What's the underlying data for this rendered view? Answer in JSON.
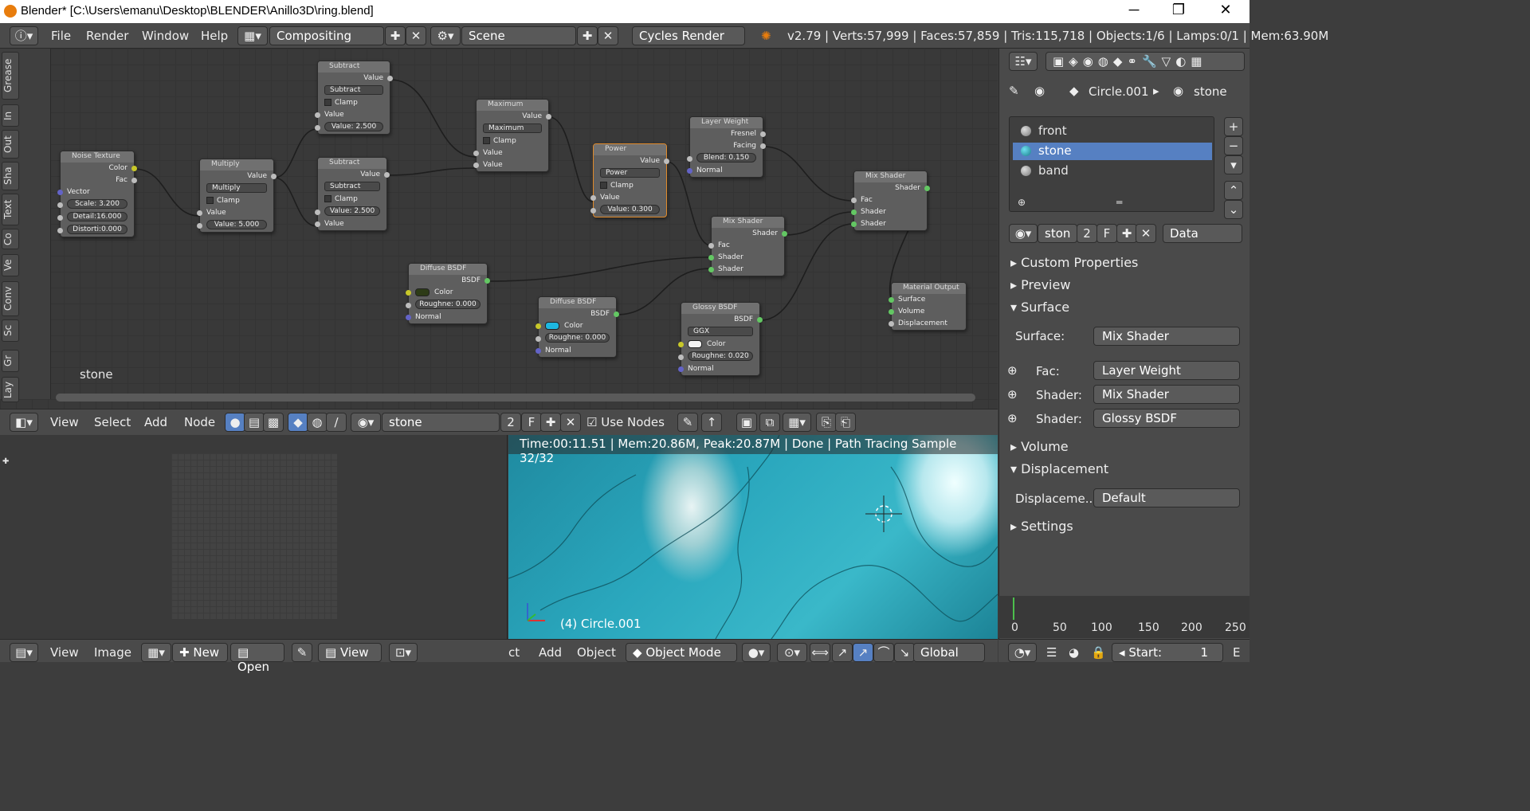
{
  "window": {
    "title": "Blender* [C:\\Users\\emanu\\Desktop\\BLENDER\\Anillo3D\\ring.blend]",
    "minimize": "─",
    "restore": "❐",
    "close": "✕"
  },
  "menu": {
    "file": "File",
    "render": "Render",
    "window": "Window",
    "help": "Help"
  },
  "workspace": "Compositing",
  "scene": "Scene",
  "engine": "Cycles Render",
  "stats": "v2.79 | Verts:57,999 | Faces:57,859 | Tris:115,718 | Objects:1/6 | Lamps:0/1 | Mem:63.90M",
  "node_editor": {
    "tabs": [
      "Grease",
      "In",
      "Out",
      "Sha",
      "Text",
      "Co",
      "Ve",
      "Conv",
      "Sc",
      "Gr",
      "Lay"
    ],
    "material_label": "stone",
    "nodes": {
      "noise": {
        "title": "Noise Texture",
        "out1": "Color",
        "out2": "Fac",
        "in1": "Vector",
        "scale": "Scale:   3.200",
        "detail": "Detail:16.000",
        "distort": "Distorti:0.000"
      },
      "multiply": {
        "title": "Multiply",
        "out": "Value",
        "op": "Multiply",
        "clamp": "Clamp",
        "in": "Value",
        "val": "Value:   5.000"
      },
      "sub1": {
        "title": "Subtract",
        "out": "Value",
        "op": "Subtract",
        "clamp": "Clamp",
        "in": "Value",
        "val": "Value: 2.500"
      },
      "sub2": {
        "title": "Subtract",
        "out": "Value",
        "op": "Subtract",
        "clamp": "Clamp",
        "val": "Value: 2.500",
        "in": "Value"
      },
      "max": {
        "title": "Maximum",
        "out": "Value",
        "op": "Maximum",
        "clamp": "Clamp",
        "in1": "Value",
        "in2": "Value"
      },
      "power": {
        "title": "Power",
        "out": "Value",
        "op": "Power",
        "clamp": "Clamp",
        "in": "Value",
        "val": "Value:   0.300"
      },
      "layerweight": {
        "title": "Layer Weight",
        "out1": "Fresnel",
        "out2": "Facing",
        "blend": "Blend:  0.150",
        "in": "Normal"
      },
      "mix1": {
        "title": "Mix Shader",
        "out": "Shader",
        "fac": "Fac",
        "s1": "Shader",
        "s2": "Shader"
      },
      "mix2": {
        "title": "Mix Shader",
        "out": "Shader",
        "fac": "Fac",
        "s1": "Shader",
        "s2": "Shader"
      },
      "diffuse1": {
        "title": "Diffuse BSDF",
        "out": "BSDF",
        "color": "Color",
        "rough": "Roughne: 0.000",
        "normal": "Normal"
      },
      "diffuse2": {
        "title": "Diffuse BSDF",
        "out": "BSDF",
        "color": "Color",
        "rough": "Roughne: 0.000",
        "normal": "Normal"
      },
      "glossy": {
        "title": "Glossy BSDF",
        "out": "BSDF",
        "dist": "GGX",
        "color": "Color",
        "rough": "Roughne: 0.020",
        "normal": "Normal"
      },
      "output": {
        "title": "Material Output",
        "surface": "Surface",
        "volume": "Volume",
        "disp": "Displacement"
      }
    }
  },
  "node_header": {
    "view": "View",
    "select": "Select",
    "add": "Add",
    "node": "Node",
    "material": "stone",
    "users": "2",
    "fake": "F",
    "use_nodes": "Use Nodes"
  },
  "render_view": {
    "status": "Time:00:11.51 | Mem:20.86M, Peak:20.87M | Done | Path Tracing Sample 32/32",
    "object": "(4) Circle.001"
  },
  "image_footer": {
    "view": "View",
    "image": "Image",
    "new": "New",
    "open": "Open",
    "view2": "View"
  },
  "view3d_footer": {
    "view_cut": "ct",
    "add": "Add",
    "object": "Object",
    "mode": "Object Mode",
    "orientation": "Global"
  },
  "properties": {
    "breadcrumb_obj": "Circle.001",
    "breadcrumb_mat": "stone",
    "materials": [
      "front",
      "stone",
      "band"
    ],
    "mat_name": "ston",
    "mat_users": "2",
    "mat_fake": "F",
    "link": "Data",
    "panels": {
      "custom": "Custom Properties",
      "preview": "Preview",
      "surface": "Surface",
      "volume": "Volume",
      "displacement": "Displacement",
      "settings": "Settings"
    },
    "surface_label": "Surface:",
    "surface_val": "Mix Shader",
    "fac_label": "Fac:",
    "fac_val": "Layer Weight",
    "shader1_label": "Shader:",
    "shader1_val": "Mix Shader",
    "shader2_label": "Shader:",
    "shader2_val": "Glossy BSDF",
    "disp_label": "Displaceme...",
    "disp_val": "Default"
  },
  "timeline": {
    "ticks": [
      "0",
      "50",
      "100",
      "150",
      "200",
      "250"
    ],
    "start": "Start:",
    "start_val": "1",
    "end_cut": "E"
  }
}
